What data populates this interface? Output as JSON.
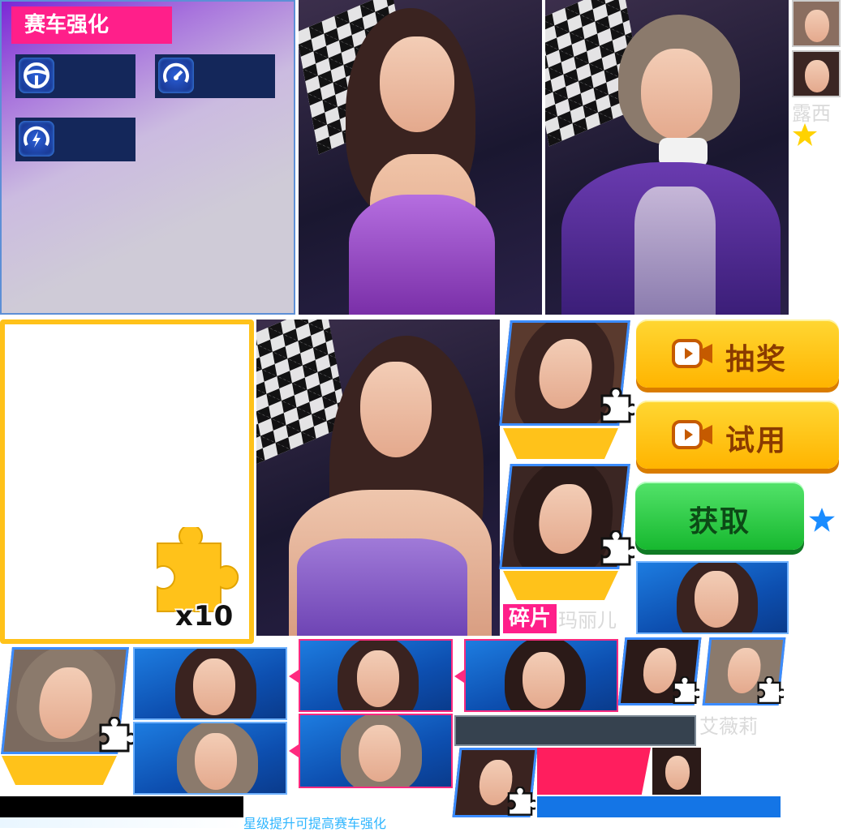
{
  "enhance_panel": {
    "title": "赛车强化",
    "stats": [
      {
        "icon": "steering-wheel-icon"
      },
      {
        "icon": "speedometer-icon"
      },
      {
        "icon": "speed-boost-icon"
      }
    ]
  },
  "characters": {
    "lucy": "露西",
    "mary": "玛丽儿",
    "avery": "艾薇莉"
  },
  "badges": {
    "shard": "碎片"
  },
  "buttons": {
    "lottery": "抽奖",
    "trial": "试用",
    "obtain": "获取"
  },
  "shard_count": "x10",
  "hint": "星级提升可提高赛车强化",
  "colors": {
    "accent_pink": "#ff1f8a",
    "yellow": "#ffc21a",
    "green": "#17b82f",
    "blue": "#1475e6",
    "star": "#ffd200",
    "blue_star": "#1a8cff"
  }
}
